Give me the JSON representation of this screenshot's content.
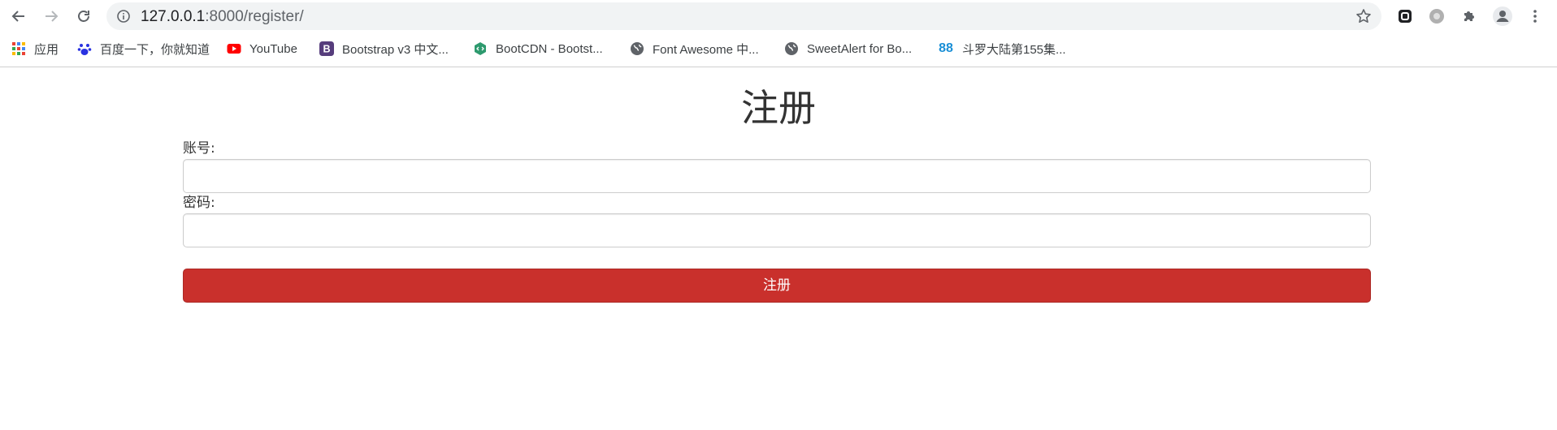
{
  "browser": {
    "url_host": "127.0.0.1",
    "url_rest": ":8000/register/",
    "bookmarks": [
      {
        "label": "应用",
        "icon": "apps-grid-icon"
      },
      {
        "label": "百度一下，你就知道",
        "icon": "baidu-paw-icon"
      },
      {
        "label": "YouTube",
        "icon": "youtube-icon"
      },
      {
        "label": "Bootstrap v3 中文...",
        "icon": "bootstrap-icon"
      },
      {
        "label": "BootCDN - Bootst...",
        "icon": "bootcdn-icon"
      },
      {
        "label": "Font Awesome 中...",
        "icon": "globe-icon"
      },
      {
        "label": "SweetAlert for Bo...",
        "icon": "globe-icon"
      },
      {
        "label": "斗罗大陆第155集...",
        "icon": "site-88-icon",
        "icon_text": "88"
      }
    ]
  },
  "page": {
    "title": "注册",
    "username_label": "账号:",
    "password_label": "密码:",
    "submit_label": "注册"
  },
  "colors": {
    "danger_button": "#c9302c",
    "omnibox_bg": "#f1f3f4"
  }
}
